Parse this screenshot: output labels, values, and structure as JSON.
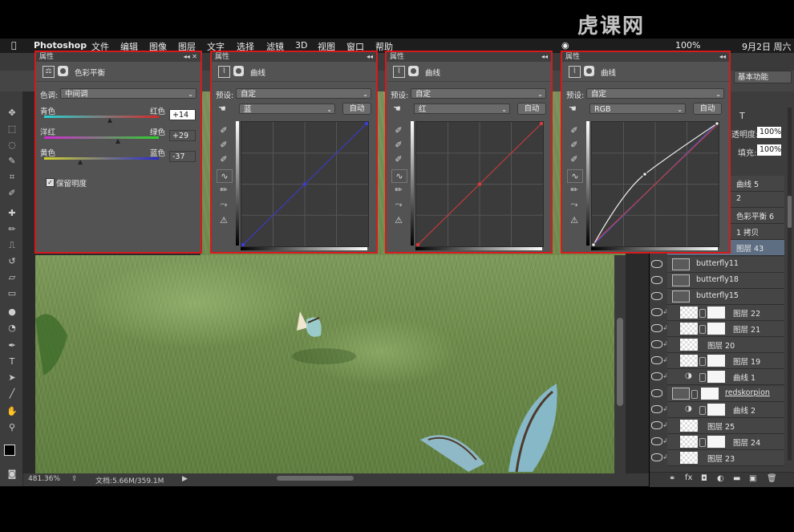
{
  "watermark": "虎课网",
  "menubar": {
    "app_name": "Photoshop",
    "items": [
      "文件",
      "编辑",
      "图像",
      "图层",
      "文字",
      "选择",
      "滤镜",
      "3D",
      "视图",
      "窗口",
      "帮助"
    ],
    "battery": "100%",
    "date": "9月2日 周六"
  },
  "workspace": "基本功能",
  "status": {
    "zoom": "481.36%",
    "doc": "文档:5.66M/359.1M"
  },
  "panels": {
    "color_balance": {
      "title": "属性",
      "header": "色彩平衡",
      "tone_label": "色调:",
      "tone_value": "中间调",
      "rows": [
        {
          "left": "青色",
          "right": "红色",
          "value": "+14",
          "knob": 0.57
        },
        {
          "left": "洋红",
          "right": "绿色",
          "value": "+29",
          "knob": 0.645
        },
        {
          "left": "黄色",
          "right": "蓝色",
          "value": "-37",
          "knob": 0.315
        }
      ],
      "preserve_label": "保留明度",
      "preserve_checked": true
    },
    "curves": [
      {
        "title": "属性",
        "header": "曲线",
        "preset_label": "预设:",
        "preset_value": "自定",
        "channel": "蓝",
        "auto": "自动",
        "color": "#3b3bd6"
      },
      {
        "title": "属性",
        "header": "曲线",
        "preset_label": "预设:",
        "preset_value": "自定",
        "channel": "红",
        "auto": "自动",
        "color": "#d63b3b"
      },
      {
        "title": "属性",
        "header": "曲线",
        "preset_label": "预设:",
        "preset_value": "自定",
        "channel": "RGB",
        "auto": "自动",
        "color": "#e0e0e0"
      }
    ]
  },
  "layers_panel": {
    "opacity_label": "不透明度:",
    "opacity_value": "100%",
    "fill_label": "填充:",
    "fill_value": "100%",
    "layers": [
      {
        "name": "曲线 5",
        "kind": "partial"
      },
      {
        "name": "2",
        "kind": "partial"
      },
      {
        "name": "色彩平衡 6",
        "kind": "partial"
      },
      {
        "name": "1 拷贝",
        "kind": "partial"
      },
      {
        "name": "图层 43",
        "kind": "partial"
      },
      {
        "name": "butterfly11",
        "kind": "smart"
      },
      {
        "name": "butterfly18",
        "kind": "smart"
      },
      {
        "name": "butterfly15",
        "kind": "smart"
      },
      {
        "name": "图层 22",
        "kind": "masked"
      },
      {
        "name": "图层 21",
        "kind": "masked"
      },
      {
        "name": "图层 20",
        "kind": "pixel"
      },
      {
        "name": "图层 19",
        "kind": "masked"
      },
      {
        "name": "曲线 1",
        "kind": "adjust"
      },
      {
        "name": "redskorpion",
        "kind": "smartmask"
      },
      {
        "name": "曲线 2",
        "kind": "adjust"
      },
      {
        "name": "图层 25",
        "kind": "pixel"
      },
      {
        "name": "图层 24",
        "kind": "masked"
      },
      {
        "name": "图层 23",
        "kind": "pixel"
      }
    ]
  }
}
